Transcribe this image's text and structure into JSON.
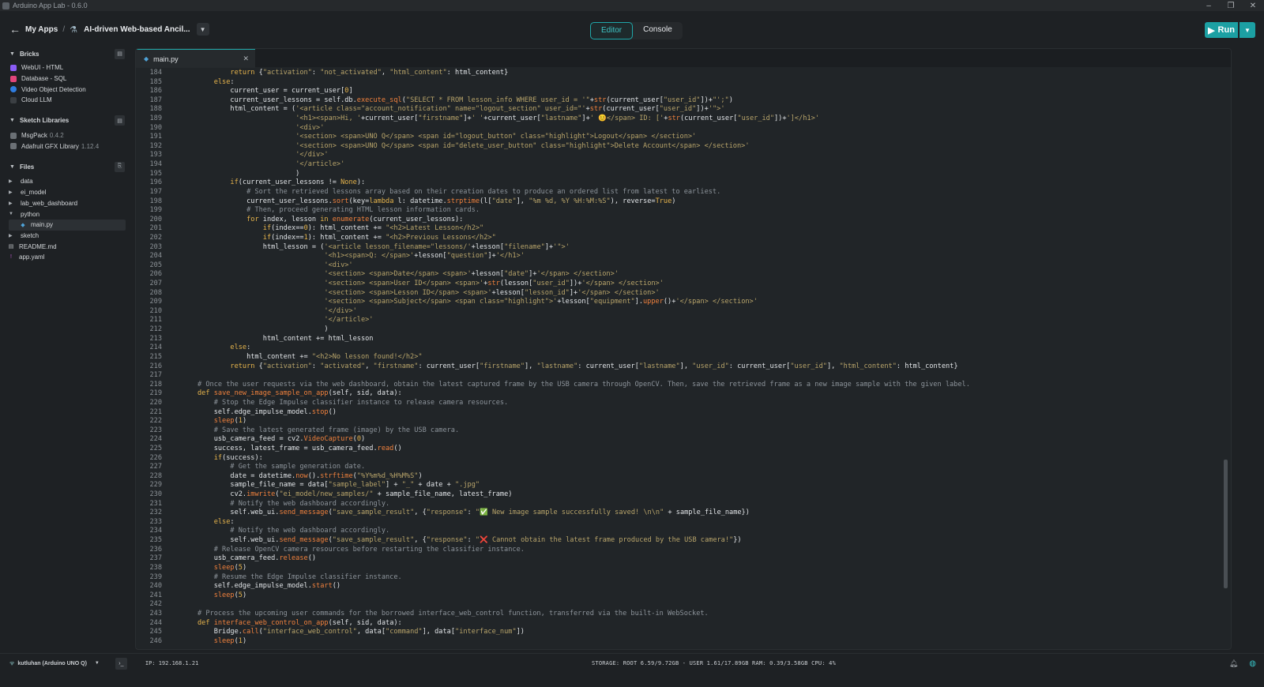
{
  "window": {
    "title": "Arduino App Lab - 0.6.0",
    "controls": [
      "–",
      "❐",
      "✕"
    ]
  },
  "header": {
    "my_apps": "My Apps",
    "separator": "/",
    "app_name": "AI-driven Web-based Ancil...",
    "tabs": [
      "Editor",
      "Console"
    ],
    "active_tab": "Editor",
    "run_label": "Run"
  },
  "sidebar": {
    "bricks": {
      "title": "Bricks",
      "items": [
        {
          "label": "WebUI - HTML",
          "color": "#8a5cf5"
        },
        {
          "label": "Database - SQL",
          "color": "#e0457b"
        },
        {
          "label": "Video Object Detection",
          "color": "#2f7de1"
        },
        {
          "label": "Cloud LLM",
          "color": "#3b3f43"
        }
      ]
    },
    "libraries": {
      "title": "Sketch Libraries",
      "items": [
        {
          "label": "MsgPack",
          "version": "0.4.2"
        },
        {
          "label": "Adafruit GFX Library",
          "version": "1.12.4"
        }
      ]
    },
    "files": {
      "title": "Files",
      "items": [
        {
          "label": "data",
          "type": "folder-closed"
        },
        {
          "label": "ei_model",
          "type": "folder-closed"
        },
        {
          "label": "lab_web_dashboard",
          "type": "folder-closed"
        },
        {
          "label": "python",
          "type": "folder-open"
        },
        {
          "label": "main.py",
          "type": "py",
          "selected": true
        },
        {
          "label": "sketch",
          "type": "folder-closed"
        },
        {
          "label": "README.md",
          "type": "md"
        },
        {
          "label": "app.yaml",
          "type": "yaml"
        }
      ]
    }
  },
  "editor": {
    "tab_label": "main.py",
    "first_line": 184,
    "lines": [
      "        return {\"activation\": \"not_activated\", \"html_content\": html_content}",
      "    else:",
      "        current_user = current_user[0]",
      "        current_user_lessons = self.db.execute_sql(\"SELECT * FROM lesson_info WHERE user_id = '\"+str(current_user[\"user_id\"])+\"';\")",
      "        html_content = ('<article class=\"account_notification\" name=\"logout_section\" user_id=\"'+str(current_user[\"user_id\"])+'\">'",
      "                        '<h1><span>Hi, '+current_user[\"firstname\"]+' '+current_user[\"lastname\"]+' 😊</span> ID: ['+str(current_user[\"user_id\"])+']</h1>'",
      "                        '<div>'",
      "                        '<section> <span>UNO Q</span> <span id=\"logout_button\" class=\"highlight\">Logout</span> </section>'",
      "                        '<section> <span>UNO Q</span> <span id=\"delete_user_button\" class=\"highlight\">Delete Account</span> </section>'",
      "                        '</div>'",
      "                        '</article>'",
      "                        )",
      "        if(current_user_lessons != None):",
      "            # Sort the retrieved lessons array based on their creation dates to produce an ordered list from latest to earliest.",
      "            current_user_lessons.sort(key=lambda l: datetime.strptime(l[\"date\"], \"%m %d, %Y %H:%M:%S\"), reverse=True)",
      "            # Then, proceed generating HTML lesson information cards.",
      "            for index, lesson in enumerate(current_user_lessons):",
      "                if(index==0): html_content += \"<h2>Latest Lesson</h2>\"",
      "                if(index==1): html_content += \"<h2>Previous Lessons</h2>\"",
      "                html_lesson = ('<article lesson_filename=\"lessons/'+lesson[\"filename\"]+'\">'",
      "                               '<h1><span>Q: </span>'+lesson[\"question\"]+'</h1>'",
      "                               '<div>'",
      "                               '<section> <span>Date</span> <span>'+lesson[\"date\"]+'</span> </section>'",
      "                               '<section> <span>User ID</span> <span>'+str(lesson[\"user_id\"])+'</span> </section>'",
      "                               '<section> <span>Lesson ID</span> <span>'+lesson[\"lesson_id\"]+'</span> </section>'",
      "                               '<section> <span>Subject</span> <span class=\"highlight\">'+lesson[\"equipment\"].upper()+'</span> </section>'",
      "                               '</div>'",
      "                               '</article>'",
      "                               )",
      "                html_content += html_lesson",
      "        else:",
      "            html_content += \"<h2>No lesson found!</h2>\"",
      "        return {\"activation\": \"activated\", \"firstname\": current_user[\"firstname\"], \"lastname\": current_user[\"lastname\"], \"user_id\": current_user[\"user_id\"], \"html_content\": html_content}",
      "",
      "# Once the user requests via the web dashboard, obtain the latest captured frame by the USB camera through OpenCV. Then, save the retrieved frame as a new image sample with the given label.",
      "def save_new_image_sample_on_app(self, sid, data):",
      "    # Stop the Edge Impulse classifier instance to release camera resources.",
      "    self.edge_impulse_model.stop()",
      "    sleep(1)",
      "    # Save the latest generated frame (image) by the USB camera.",
      "    usb_camera_feed = cv2.VideoCapture(0)",
      "    success, latest_frame = usb_camera_feed.read()",
      "    if(success):",
      "        # Get the sample generation date.",
      "        date = datetime.now().strftime(\"%Y%m%d_%H%M%S\")",
      "        sample_file_name = data[\"sample_label\"] + \"_\" + date + \".jpg\"",
      "        cv2.imwrite(\"ei_model/new_samples/\" + sample_file_name, latest_frame)",
      "        # Notify the web dashboard accordingly.",
      "        self.web_ui.send_message(\"save_sample_result\", {\"response\": \"✅ New image sample successfully saved! \\n\\n\" + sample_file_name})",
      "    else:",
      "        # Notify the web dashboard accordingly.",
      "        self.web_ui.send_message(\"save_sample_result\", {\"response\": \"❌ Cannot obtain the latest frame produced by the USB camera!\"})",
      "    # Release OpenCV camera resources before restarting the classifier instance.",
      "    usb_camera_feed.release()",
      "    sleep(5)",
      "    # Resume the Edge Impulse classifier instance.",
      "    self.edge_impulse_model.start()",
      "    sleep(5)",
      "",
      "# Process the upcoming user commands for the borrowed interface_web_control function, transferred via the built-in WebSocket.",
      "def interface_web_control_on_app(self, sid, data):",
      "    Bridge.call(\"interface_web_control\", data[\"command\"], data[\"interface_num\"])",
      "    sleep(1)"
    ]
  },
  "status": {
    "board": "kutluhan (Arduino UNO Q)",
    "ip": "IP: 192.168.1.21",
    "stats": "STORAGE: ROOT 6.59/9.72GB - USER 1.61/17.89GB   RAM: 0.39/3.58GB   CPU: 4%"
  }
}
